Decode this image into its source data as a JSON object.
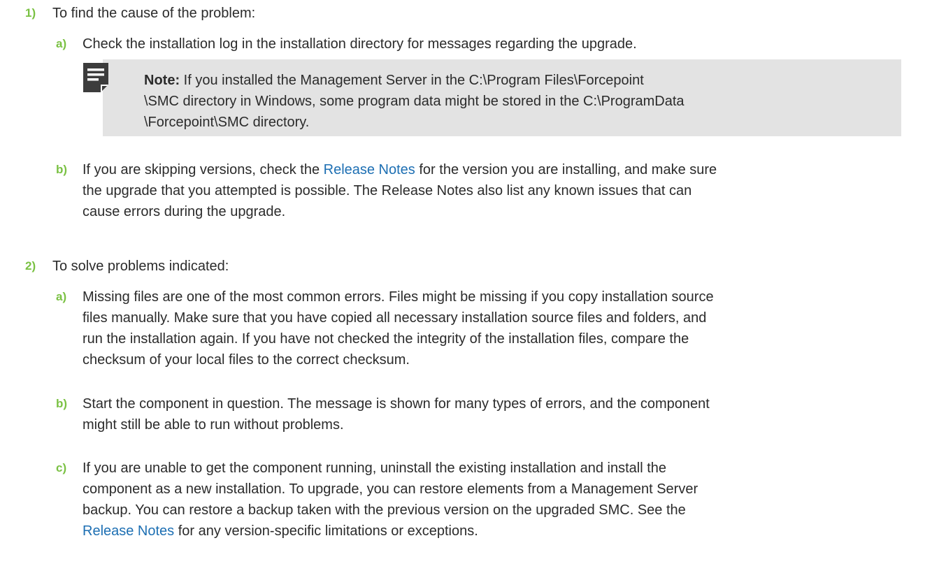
{
  "steps": [
    {
      "num": "1)",
      "text": "To find the cause of the problem:",
      "subs": [
        {
          "letter": "a)",
          "text": "Check the installation log in the installation directory for messages regarding the upgrade."
        },
        {
          "letter": "b)",
          "pre": "If you are skipping versions, check the ",
          "link": "Release Notes",
          "post": " for the version you are installing, and make sure\nthe upgrade that you attempted is possible. The Release Notes also list any known issues that can\ncause errors during the upgrade."
        }
      ]
    },
    {
      "num": "2)",
      "text": "To solve problems indicated:",
      "subs": [
        {
          "letter": "a)",
          "text": "Missing files are one of the most common errors. Files might be missing if you copy installation source\nfiles manually. Make sure that you have copied all necessary installation source files and folders, and\nrun the installation again. If you have not checked the integrity of the installation files, compare the\nchecksum of your local files to the correct checksum."
        },
        {
          "letter": "b)",
          "text": "Start the component in question. The message is shown for many types of errors, and the component\nmight still be able to run without problems."
        },
        {
          "letter": "c)",
          "pre": "If you are unable to get the component running, uninstall the existing installation and install the\ncomponent as a new installation. To upgrade, you can restore elements from a Management Server\nbackup. You can restore a backup taken with the previous version on the upgraded SMC. See the\n",
          "link": "Release Notes",
          "post": " for any version-specific limitations or exceptions."
        }
      ]
    }
  ],
  "note": {
    "icon": "note-icon",
    "label": "Note:",
    "text": " If you installed the Management Server in the C:\\Program Files\\Forcepoint\n\\SMC directory in Windows, some program data might be stored in the C:\\ProgramData\n\\Forcepoint\\SMC directory."
  },
  "colors": {
    "accent": "#7ac143",
    "link": "#1d6fb3",
    "note_bg": "#e3e3e3",
    "icon": "#3c3c3c"
  }
}
